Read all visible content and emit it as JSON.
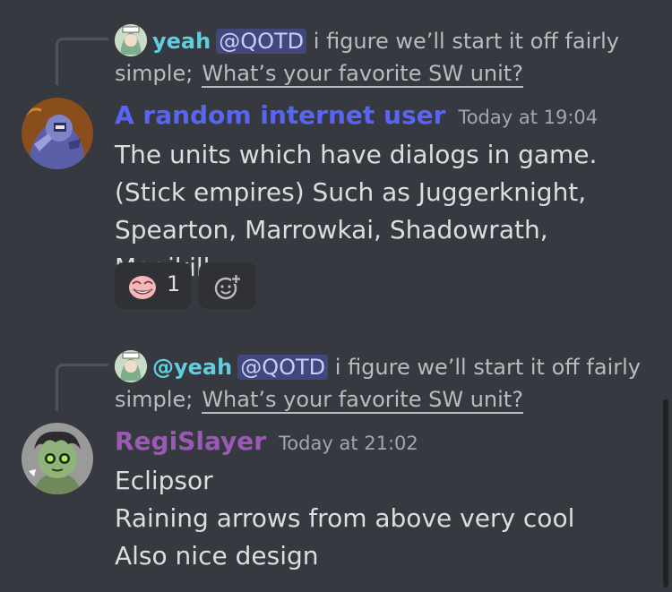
{
  "messages": [
    {
      "reply": {
        "author": "yeah",
        "mention": "@QOTD",
        "text": "i figure we’ll start it off fairly simple;",
        "snippet": "What’s your favorite SW unit?"
      },
      "author": "A random internet user",
      "author_color": "#5865f2",
      "timestamp": "Today at 19:04",
      "lines": [
        "The units which have dialogs in game.(Stick empires) Such as Juggerknight, Spearton, Marrowkai, Shadowrath, Magikill..."
      ],
      "reactions": [
        {
          "emoji": "trollface-emoji",
          "count": "1"
        }
      ]
    },
    {
      "reply": {
        "author": "@yeah",
        "mention": "@QOTD",
        "text": "i figure we’ll start it off fairly simple;",
        "snippet": "What’s your favorite SW unit?"
      },
      "author": "RegiSlayer",
      "author_color": "#9b59b6",
      "timestamp": "Today at 21:02",
      "lines": [
        "Eclipsor",
        "Raining arrows from above very cool",
        "Also nice design"
      ]
    }
  ],
  "colors": {
    "background": "#36393f",
    "reply_name": "#5fcfe0",
    "mention_bg": "#4a4f86"
  }
}
